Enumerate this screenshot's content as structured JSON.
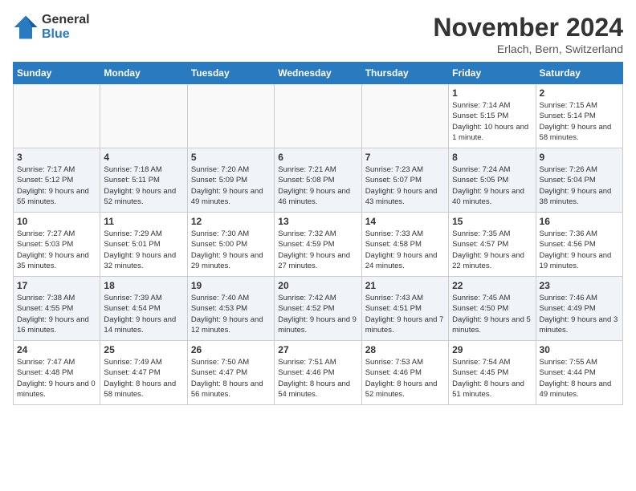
{
  "logo": {
    "line1": "General",
    "line2": "Blue"
  },
  "title": "November 2024",
  "location": "Erlach, Bern, Switzerland",
  "days_of_week": [
    "Sunday",
    "Monday",
    "Tuesday",
    "Wednesday",
    "Thursday",
    "Friday",
    "Saturday"
  ],
  "weeks": [
    [
      {
        "day": "",
        "info": ""
      },
      {
        "day": "",
        "info": ""
      },
      {
        "day": "",
        "info": ""
      },
      {
        "day": "",
        "info": ""
      },
      {
        "day": "",
        "info": ""
      },
      {
        "day": "1",
        "info": "Sunrise: 7:14 AM\nSunset: 5:15 PM\nDaylight: 10 hours and 1 minute."
      },
      {
        "day": "2",
        "info": "Sunrise: 7:15 AM\nSunset: 5:14 PM\nDaylight: 9 hours and 58 minutes."
      }
    ],
    [
      {
        "day": "3",
        "info": "Sunrise: 7:17 AM\nSunset: 5:12 PM\nDaylight: 9 hours and 55 minutes."
      },
      {
        "day": "4",
        "info": "Sunrise: 7:18 AM\nSunset: 5:11 PM\nDaylight: 9 hours and 52 minutes."
      },
      {
        "day": "5",
        "info": "Sunrise: 7:20 AM\nSunset: 5:09 PM\nDaylight: 9 hours and 49 minutes."
      },
      {
        "day": "6",
        "info": "Sunrise: 7:21 AM\nSunset: 5:08 PM\nDaylight: 9 hours and 46 minutes."
      },
      {
        "day": "7",
        "info": "Sunrise: 7:23 AM\nSunset: 5:07 PM\nDaylight: 9 hours and 43 minutes."
      },
      {
        "day": "8",
        "info": "Sunrise: 7:24 AM\nSunset: 5:05 PM\nDaylight: 9 hours and 40 minutes."
      },
      {
        "day": "9",
        "info": "Sunrise: 7:26 AM\nSunset: 5:04 PM\nDaylight: 9 hours and 38 minutes."
      }
    ],
    [
      {
        "day": "10",
        "info": "Sunrise: 7:27 AM\nSunset: 5:03 PM\nDaylight: 9 hours and 35 minutes."
      },
      {
        "day": "11",
        "info": "Sunrise: 7:29 AM\nSunset: 5:01 PM\nDaylight: 9 hours and 32 minutes."
      },
      {
        "day": "12",
        "info": "Sunrise: 7:30 AM\nSunset: 5:00 PM\nDaylight: 9 hours and 29 minutes."
      },
      {
        "day": "13",
        "info": "Sunrise: 7:32 AM\nSunset: 4:59 PM\nDaylight: 9 hours and 27 minutes."
      },
      {
        "day": "14",
        "info": "Sunrise: 7:33 AM\nSunset: 4:58 PM\nDaylight: 9 hours and 24 minutes."
      },
      {
        "day": "15",
        "info": "Sunrise: 7:35 AM\nSunset: 4:57 PM\nDaylight: 9 hours and 22 minutes."
      },
      {
        "day": "16",
        "info": "Sunrise: 7:36 AM\nSunset: 4:56 PM\nDaylight: 9 hours and 19 minutes."
      }
    ],
    [
      {
        "day": "17",
        "info": "Sunrise: 7:38 AM\nSunset: 4:55 PM\nDaylight: 9 hours and 16 minutes."
      },
      {
        "day": "18",
        "info": "Sunrise: 7:39 AM\nSunset: 4:54 PM\nDaylight: 9 hours and 14 minutes."
      },
      {
        "day": "19",
        "info": "Sunrise: 7:40 AM\nSunset: 4:53 PM\nDaylight: 9 hours and 12 minutes."
      },
      {
        "day": "20",
        "info": "Sunrise: 7:42 AM\nSunset: 4:52 PM\nDaylight: 9 hours and 9 minutes."
      },
      {
        "day": "21",
        "info": "Sunrise: 7:43 AM\nSunset: 4:51 PM\nDaylight: 9 hours and 7 minutes."
      },
      {
        "day": "22",
        "info": "Sunrise: 7:45 AM\nSunset: 4:50 PM\nDaylight: 9 hours and 5 minutes."
      },
      {
        "day": "23",
        "info": "Sunrise: 7:46 AM\nSunset: 4:49 PM\nDaylight: 9 hours and 3 minutes."
      }
    ],
    [
      {
        "day": "24",
        "info": "Sunrise: 7:47 AM\nSunset: 4:48 PM\nDaylight: 9 hours and 0 minutes."
      },
      {
        "day": "25",
        "info": "Sunrise: 7:49 AM\nSunset: 4:47 PM\nDaylight: 8 hours and 58 minutes."
      },
      {
        "day": "26",
        "info": "Sunrise: 7:50 AM\nSunset: 4:47 PM\nDaylight: 8 hours and 56 minutes."
      },
      {
        "day": "27",
        "info": "Sunrise: 7:51 AM\nSunset: 4:46 PM\nDaylight: 8 hours and 54 minutes."
      },
      {
        "day": "28",
        "info": "Sunrise: 7:53 AM\nSunset: 4:46 PM\nDaylight: 8 hours and 52 minutes."
      },
      {
        "day": "29",
        "info": "Sunrise: 7:54 AM\nSunset: 4:45 PM\nDaylight: 8 hours and 51 minutes."
      },
      {
        "day": "30",
        "info": "Sunrise: 7:55 AM\nSunset: 4:44 PM\nDaylight: 8 hours and 49 minutes."
      }
    ]
  ]
}
